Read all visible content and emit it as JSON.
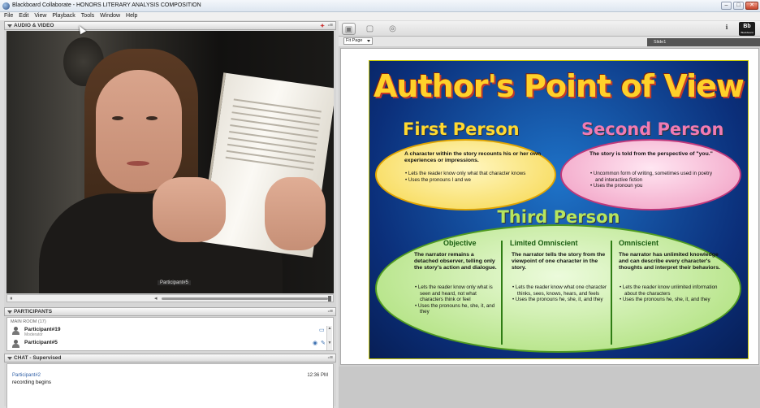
{
  "window": {
    "title": "Blackboard Collaborate - HONORS LITERARY ANALYSIS COMPOSITION",
    "buttons": [
      "–",
      "□",
      "✕"
    ]
  },
  "menu": [
    "File",
    "Edit",
    "View",
    "Playback",
    "Tools",
    "Window",
    "Help"
  ],
  "audio_video": {
    "title": "AUDIO & VIDEO",
    "video_label": "Participant#5"
  },
  "participants": {
    "title": "PARTICIPANTS",
    "room": "MAIN ROOM (17)",
    "list": [
      {
        "name": "Participant#19",
        "role": "Moderator"
      },
      {
        "name": "Participant#5",
        "role": ""
      }
    ]
  },
  "chat": {
    "title": "CHAT - Supervised",
    "messages": [
      {
        "sender": "Participant#2",
        "time": "12:36 PM",
        "text": "recording begins"
      }
    ]
  },
  "whiteboard": {
    "zoom": "Fit Page",
    "slide": "Slide1",
    "logo": "Bb",
    "logo_sub": "Blackboard"
  },
  "poster": {
    "title": "Author's Point of View",
    "first": {
      "heading": "First Person",
      "desc": "A character within the story recounts his or her own experiences or impressions.",
      "bullets": [
        "Lets the reader know only what that character knows",
        "Uses the pronouns I and we"
      ]
    },
    "second": {
      "heading": "Second Person",
      "desc": "The story is told from the perspective of \"you.\"",
      "bullets": [
        "Uncommon form of writing, sometimes used in poetry and interactive fiction",
        "Uses the pronoun you"
      ]
    },
    "third": {
      "heading": "Third Person",
      "columns": [
        {
          "title": "Objective",
          "desc": "The narrator remains a detached observer, telling only the story's action and dialogue.",
          "bullets": [
            "Lets the reader know only what is seen and heard, not what characters think or feel",
            "Uses the pronouns he, she, it, and they"
          ]
        },
        {
          "title": "Limited Omniscient",
          "desc": "The narrator tells the story from the viewpoint of one character in the story.",
          "bullets": [
            "Lets the reader know what one character thinks, sees, knows, hears, and feels",
            "Uses the pronouns he, she, it, and they"
          ]
        },
        {
          "title": "Omniscient",
          "desc": "The narrator has unlimited knowledge and can describe every character's thoughts and interpret their behaviors.",
          "bullets": [
            "Lets the reader know unlimited information about the characters",
            "Uses the pronouns he, she, it, and they"
          ]
        }
      ]
    }
  },
  "colors": {
    "poster_bg": "#0b2f7a",
    "title_yellow": "#ffd12a",
    "first_yellow": "#f6d64a",
    "second_pink": "#f09ac0",
    "third_green": "#a6dd6f"
  }
}
